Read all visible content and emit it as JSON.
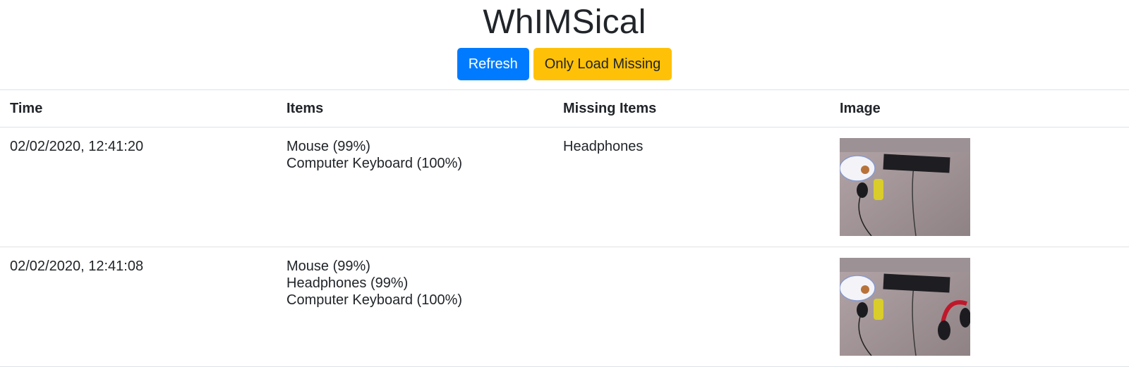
{
  "app": {
    "title": "WhIMSical"
  },
  "toolbar": {
    "refresh_label": "Refresh",
    "only_missing_label": "Only Load Missing"
  },
  "table": {
    "headers": [
      "Time",
      "Items",
      "Missing Items",
      "Image"
    ],
    "rows": [
      {
        "time": "02/02/2020, 12:41:20",
        "items": [
          "Mouse (99%)",
          "Computer Keyboard (100%)"
        ],
        "missing": [
          "Headphones"
        ],
        "image": "desk-photo-without-headphones"
      },
      {
        "time": "02/02/2020, 12:41:08",
        "items": [
          "Mouse (99%)",
          "Headphones (99%)",
          "Computer Keyboard (100%)"
        ],
        "missing": [],
        "image": "desk-photo-with-headphones"
      }
    ]
  },
  "colors": {
    "primary": "#007bff",
    "warning": "#ffc107",
    "text": "#212529",
    "border": "#dee2e6"
  }
}
